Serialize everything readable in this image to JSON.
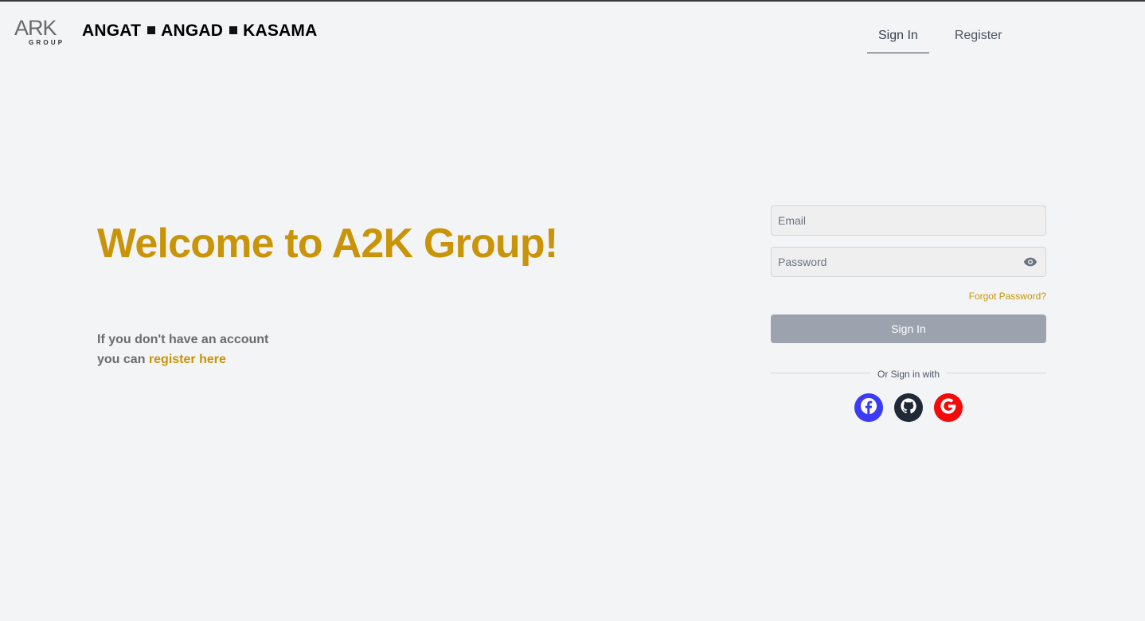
{
  "header": {
    "logo": {
      "text": "ARK",
      "subtext": "GROUP"
    },
    "brand": {
      "parts": [
        "ANGAT",
        "ANGAD",
        "KASAMA"
      ]
    },
    "nav": {
      "signin_label": "Sign In",
      "register_label": "Register",
      "active": "signin"
    }
  },
  "main": {
    "welcome_title": "Welcome to A2K Group!",
    "account_note_line1": "If you don't have an account",
    "account_note_prefix": "you can",
    "register_link": "register here"
  },
  "form": {
    "email_placeholder": "Email",
    "email_value": "",
    "password_placeholder": "Password",
    "password_value": "",
    "password_toggle_icon": "eye-icon",
    "forgot_label": "Forgot Password?",
    "signin_button": "Sign In",
    "divider_text": "Or Sign in with",
    "socials": [
      {
        "name": "facebook",
        "icon": "facebook-icon",
        "color": "#3b3bf6"
      },
      {
        "name": "github",
        "icon": "github-icon",
        "color": "#1f2937"
      },
      {
        "name": "google",
        "icon": "google-icon",
        "color": "#f50a0a"
      }
    ]
  },
  "colors": {
    "accent": "#c99408",
    "background": "#f3f4f6",
    "button_disabled": "#9ca3af"
  }
}
